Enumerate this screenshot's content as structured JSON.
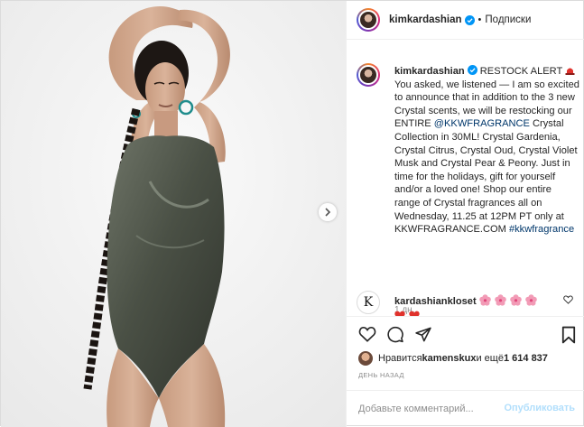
{
  "post": {
    "header": {
      "username": "kimkardashian",
      "separator": "•",
      "follow_label": "Подписки"
    },
    "caption": {
      "username": "kimkardashian",
      "text_before_link": " RESTOCK ALERT ",
      "text_after_siren": " You asked, we listened — I am so excited to announce that in addition to the 3 new Crystal scents, we will be restocking our ENTIRE ",
      "mention": "@KKWFRAGRANCE",
      "text_middle": " Crystal Collection in 30ML! Crystal Gardenia, Crystal Citrus, Crystal Oud, Crystal Violet Musk and Crystal Pear & Peony. Just in time for the holidays, gift for yourself and/or a loved one! Shop our entire range of Crystal fragrances all on Wednesday, 11.25 at 12PM PT only at KKWFRAGRANCE.COM ",
      "hashtag": "#kkwfragrance",
      "time": "1 дн."
    },
    "comment": {
      "avatar_letter": "K",
      "username": "kardashiankloset",
      "emojis": [
        "pink-flower",
        "pink-flower",
        "pink-flower",
        "pink-flower",
        "red-heart",
        "red-heart"
      ]
    },
    "likes": {
      "prefix": "Нравится ",
      "user": "kamenskux",
      "middle": " и ещё ",
      "count": "1 614 837"
    },
    "date": "ДЕНЬ НАЗАД",
    "add_comment": {
      "placeholder": "Добавьте комментарий...",
      "publish_label": "Опубликовать"
    },
    "colors": {
      "verified": "#0095f6",
      "link": "#00376b",
      "publish_disabled": "#b2dffc",
      "secondary_text": "#8e8e8e"
    }
  }
}
